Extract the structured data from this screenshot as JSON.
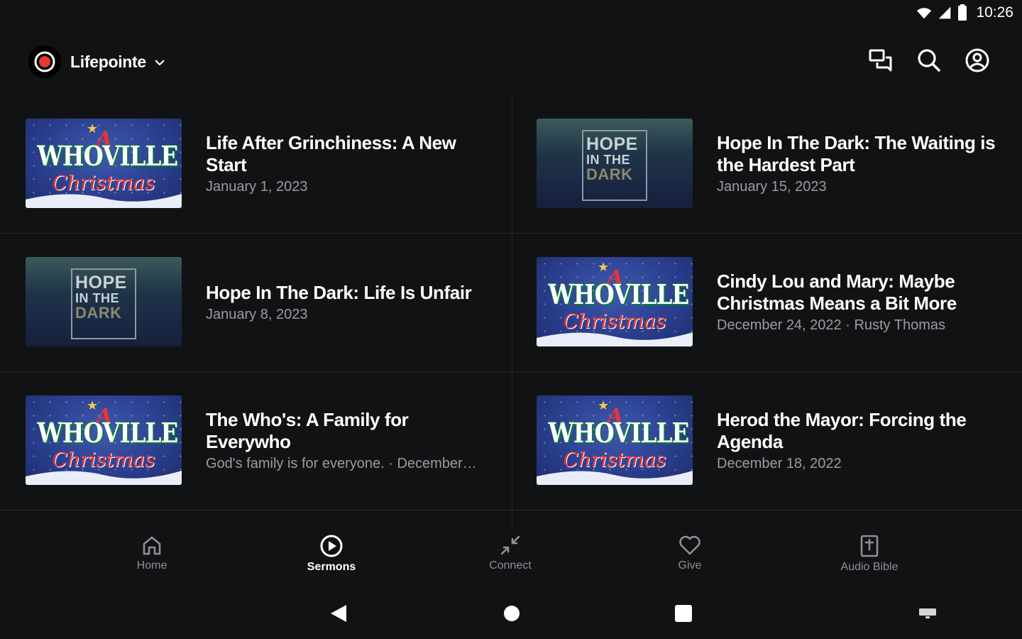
{
  "status_bar": {
    "time": "10:26"
  },
  "header": {
    "brand_name": "Lifepointe"
  },
  "sermons": [
    {
      "title": "Life After Grinchiness: A New Start",
      "meta": "January 1, 2023",
      "thumbnail": "whoville-christmas"
    },
    {
      "title": "Hope In The Dark: The Waiting is the Hardest Part",
      "meta": "January 15, 2023",
      "thumbnail": "hope-in-the-dark"
    },
    {
      "title": "Hope In The Dark: Life Is Unfair",
      "meta": "January 8, 2023",
      "thumbnail": "hope-in-the-dark"
    },
    {
      "title": "Cindy Lou and Mary:  Maybe Christmas Means a Bit More",
      "meta": "December 24, 2022 · Rusty Thomas",
      "thumbnail": "whoville-christmas"
    },
    {
      "title": "The Who's: A Family for Everywho",
      "meta": "God's family is for everyone. · December…",
      "thumbnail": "whoville-christmas"
    },
    {
      "title": "Herod the Mayor: Forcing the Agenda",
      "meta": "December 18, 2022",
      "thumbnail": "whoville-christmas"
    }
  ],
  "thumb_text": {
    "whoville_a": "A",
    "whoville_main": "WHOVILLE",
    "whoville_sub": "Christmas",
    "hope_1": "HOPE",
    "hope_2": "IN THE",
    "hope_3": "DARK"
  },
  "nav": {
    "items": [
      {
        "label": "Home",
        "icon": "home-icon"
      },
      {
        "label": "Sermons",
        "icon": "play-circle-icon",
        "active": true
      },
      {
        "label": "Connect",
        "icon": "connect-icon"
      },
      {
        "label": "Give",
        "icon": "heart-icon"
      },
      {
        "label": "Audio Bible",
        "icon": "bible-icon"
      }
    ]
  },
  "colors": {
    "background": "#111214",
    "divider": "#24262a",
    "muted_text": "#9a9ca0",
    "nav_inactive": "#8e9094"
  }
}
